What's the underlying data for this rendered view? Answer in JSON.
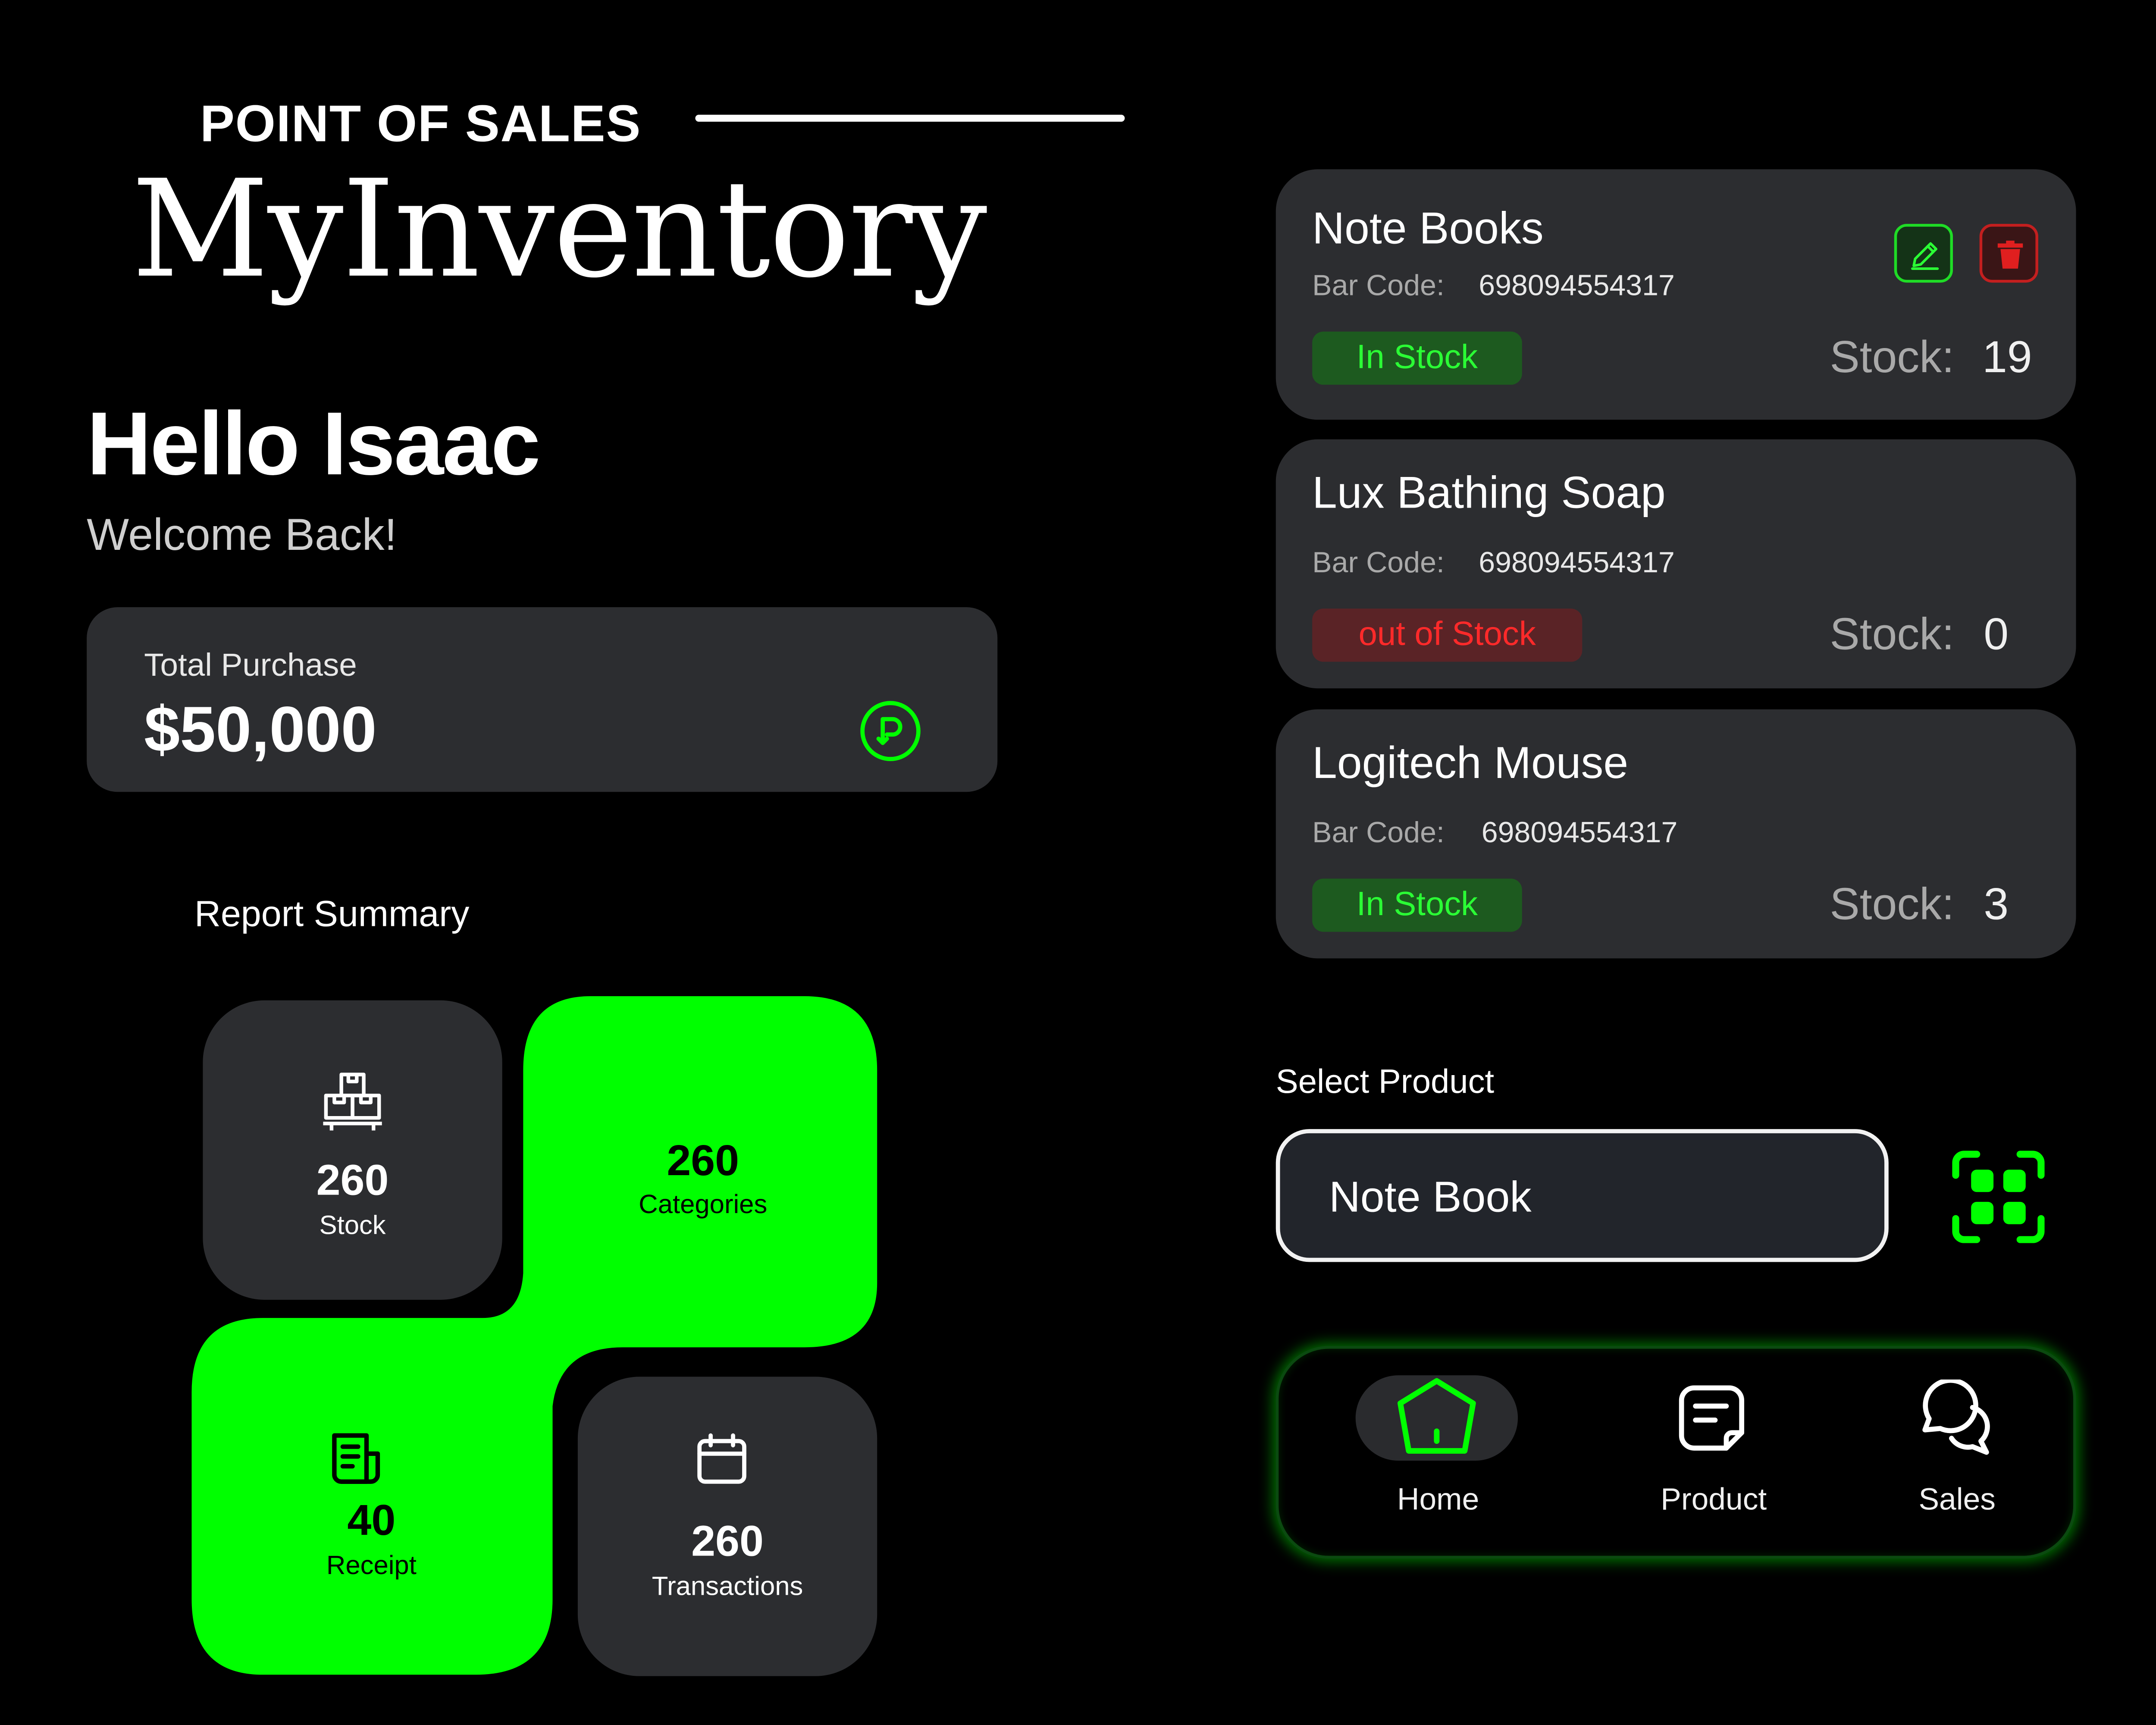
{
  "header": {
    "kicker": "POINT OF SALES",
    "logo": "MyInventory"
  },
  "greeting": {
    "hello": "Hello Isaac",
    "welcome": "Welcome Back!"
  },
  "purchase": {
    "label": "Total Purchase",
    "value": "$50,000",
    "icon": "payment-circle-icon"
  },
  "report": {
    "title": "Report Summary",
    "tiles": [
      {
        "value": "260",
        "label": "Stock",
        "icon": "boxes-icon"
      },
      {
        "value": "260",
        "label": "Categories"
      },
      {
        "value": "40",
        "label": "Receipt",
        "icon": "receipt-icon"
      },
      {
        "value": "260",
        "label": "Transactions",
        "icon": "calendar-icon"
      }
    ]
  },
  "products": [
    {
      "name": "Note Books",
      "barcode_label": "Bar Code:",
      "barcode": "698094554317",
      "status": "In Stock",
      "stock_label": "Stock:",
      "stock": "19"
    },
    {
      "name": "Lux Bathing Soap",
      "barcode_label": "Bar Code:",
      "barcode": "698094554317",
      "status": "out of Stock",
      "stock_label": "Stock:",
      "stock": "0"
    },
    {
      "name": "Logitech Mouse",
      "barcode_label": "Bar Code:",
      "barcode": "698094554317",
      "status": "In Stock",
      "stock_label": "Stock:",
      "stock": "3"
    }
  ],
  "select": {
    "label": "Select Product",
    "value": "Note Book",
    "scan_icon": "scan-icon"
  },
  "nav": {
    "items": [
      {
        "label": "Home",
        "icon": "home-icon",
        "active": true
      },
      {
        "label": "Product",
        "icon": "product-note-icon",
        "active": false
      },
      {
        "label": "Sales",
        "icon": "chat-bubbles-icon",
        "active": false
      }
    ]
  },
  "colors": {
    "accent": "#00ff00",
    "card": "#2c2d30",
    "danger": "#ff2a2a",
    "background": "#000000"
  }
}
